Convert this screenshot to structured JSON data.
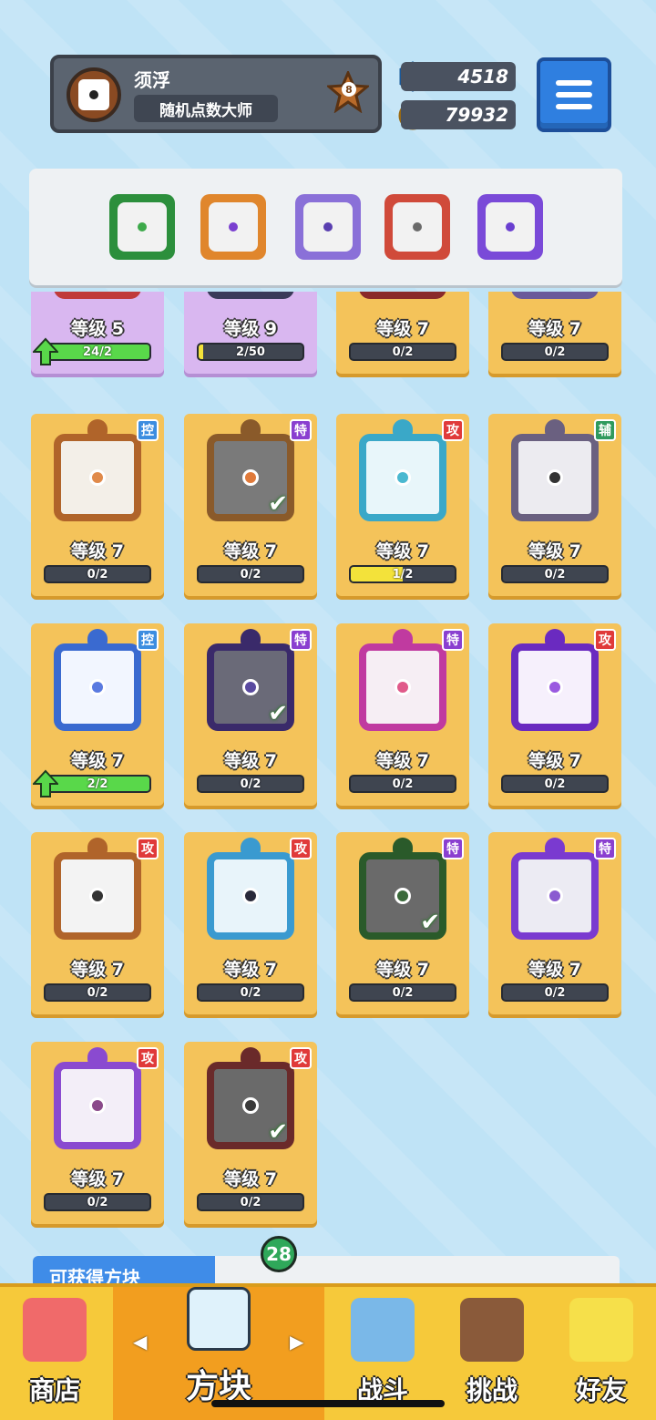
{
  "player": {
    "name": "须浮",
    "title": "随机点数大师",
    "rank": "8"
  },
  "currency": {
    "gems": "4518",
    "coins": "79932"
  },
  "deck": [
    {
      "icon": "wind-die-icon",
      "color": "#3da94a",
      "frame": "#2c8f3c"
    },
    {
      "icon": "infinity-die-icon",
      "color": "#7a3fd0",
      "frame": "#e0862c"
    },
    {
      "icon": "lightning-die-icon",
      "color": "#5a3fb0",
      "frame": "#8a70d8"
    },
    {
      "icon": "saw-die-icon",
      "color": "#6a6a6a",
      "frame": "#d04a3a"
    },
    {
      "icon": "mirror-die-icon",
      "color": "#6a3fd0",
      "frame": "#7a4ad8"
    }
  ],
  "cards": [
    {
      "level": "等级 5",
      "progress": "24/2",
      "fill": 1.0,
      "fill_color": "green",
      "upgradable": true,
      "bg": "purple",
      "tag": "",
      "tag_type": "",
      "frame": "#c03a3a",
      "pip": "#c03a3a",
      "face": "#f3f3f3",
      "checked": false,
      "icon": "die-icon"
    },
    {
      "level": "等级 9",
      "progress": "2/50",
      "fill": 0.04,
      "fill_color": "yellow",
      "upgradable": false,
      "bg": "purple",
      "tag": "",
      "tag_type": "",
      "frame": "#3a3a5a",
      "pip": "#3a3a5a",
      "face": "#f3f3f3",
      "checked": false,
      "icon": "die-icon"
    },
    {
      "level": "等级 7",
      "progress": "0/2",
      "fill": 0,
      "fill_color": "green",
      "upgradable": false,
      "bg": "gold",
      "tag": "",
      "tag_type": "",
      "frame": "#8a2a2a",
      "pip": "#8a2a2a",
      "face": "#f3f3f3",
      "checked": false,
      "icon": "die-icon"
    },
    {
      "level": "等级 7",
      "progress": "0/2",
      "fill": 0,
      "fill_color": "green",
      "upgradable": false,
      "bg": "gold",
      "tag": "",
      "tag_type": "",
      "frame": "#6a5a9a",
      "pip": "#6a5a9a",
      "face": "#f3f3f3",
      "checked": false,
      "icon": "die-icon"
    },
    {
      "level": "等级 7",
      "progress": "0/2",
      "fill": 0,
      "fill_color": "green",
      "upgradable": false,
      "bg": "gold",
      "tag": "控",
      "tag_type": "ctrl",
      "frame": "#b0642a",
      "pip": "#e08a4a",
      "face": "#f3efe8",
      "checked": false,
      "icon": "sand-die-icon"
    },
    {
      "level": "等级 7",
      "progress": "0/2",
      "fill": 0,
      "fill_color": "green",
      "upgradable": false,
      "bg": "gold",
      "tag": "特",
      "tag_type": "spec",
      "frame": "#8a5a2a",
      "pip": "#e07a3a",
      "face": "#7a7a7a",
      "checked": true,
      "icon": "infinity-die-icon"
    },
    {
      "level": "等级 7",
      "progress": "1/2",
      "fill": 0.5,
      "fill_color": "yellow",
      "upgradable": false,
      "bg": "gold",
      "tag": "攻",
      "tag_type": "atk",
      "frame": "#3aa8c8",
      "pip": "#4ab8d0",
      "face": "#e8f6fa",
      "checked": false,
      "icon": "ice-blade-die-icon"
    },
    {
      "level": "等级 7",
      "progress": "0/2",
      "fill": 0,
      "fill_color": "green",
      "upgradable": false,
      "bg": "gold",
      "tag": "辅",
      "tag_type": "sup",
      "frame": "#6a6080",
      "pip": "#333333",
      "face": "#ecebf0",
      "checked": false,
      "icon": "jaw-die-icon"
    },
    {
      "level": "等级 7",
      "progress": "2/2",
      "fill": 1.0,
      "fill_color": "green",
      "upgradable": true,
      "bg": "gold",
      "tag": "控",
      "tag_type": "ctrl",
      "frame": "#3a6ad0",
      "pip": "#5a7ae0",
      "face": "#f2f6ff",
      "checked": false,
      "icon": "snowflake-die-icon"
    },
    {
      "level": "等级 7",
      "progress": "0/2",
      "fill": 0,
      "fill_color": "green",
      "upgradable": false,
      "bg": "gold",
      "tag": "特",
      "tag_type": "spec",
      "frame": "#3a2a6a",
      "pip": "#5a4aa0",
      "face": "#6a6a78",
      "checked": true,
      "icon": "cycle-die-icon"
    },
    {
      "level": "等级 7",
      "progress": "0/2",
      "fill": 0,
      "fill_color": "green",
      "upgradable": false,
      "bg": "gold",
      "tag": "特",
      "tag_type": "spec",
      "frame": "#c03aa0",
      "pip": "#e05a8a",
      "face": "#f6eef4",
      "checked": false,
      "icon": "syringe-die-icon"
    },
    {
      "level": "等级 7",
      "progress": "0/2",
      "fill": 0,
      "fill_color": "green",
      "upgradable": false,
      "bg": "gold",
      "tag": "攻",
      "tag_type": "atk",
      "frame": "#6a2ac0",
      "pip": "#9a5ae0",
      "face": "#f6f0fc",
      "checked": false,
      "icon": "orbit-die-icon"
    },
    {
      "level": "等级 7",
      "progress": "0/2",
      "fill": 0,
      "fill_color": "green",
      "upgradable": false,
      "bg": "gold",
      "tag": "攻",
      "tag_type": "atk",
      "frame": "#b0642a",
      "pip": "#333333",
      "face": "#f3f3f3",
      "checked": false,
      "icon": "gun-die-icon"
    },
    {
      "level": "等级 7",
      "progress": "0/2",
      "fill": 0,
      "fill_color": "green",
      "upgradable": false,
      "bg": "gold",
      "tag": "攻",
      "tag_type": "atk",
      "frame": "#3a9ad0",
      "pip": "#2a2a3a",
      "face": "#e8f4fa",
      "checked": false,
      "icon": "whirlpool-die-icon"
    },
    {
      "level": "等级 7",
      "progress": "0/2",
      "fill": 0,
      "fill_color": "green",
      "upgradable": false,
      "bg": "gold",
      "tag": "特",
      "tag_type": "spec",
      "frame": "#2a5a2a",
      "pip": "#3a6a3a",
      "face": "#6a6a6a",
      "checked": true,
      "icon": "wind-die-icon"
    },
    {
      "level": "等级 7",
      "progress": "0/2",
      "fill": 0,
      "fill_color": "green",
      "upgradable": false,
      "bg": "gold",
      "tag": "特",
      "tag_type": "spec",
      "frame": "#7a3ad0",
      "pip": "#8a5ad0",
      "face": "#ecebf3",
      "checked": false,
      "icon": "mirror-die-icon"
    },
    {
      "level": "等级 7",
      "progress": "0/2",
      "fill": 0,
      "fill_color": "green",
      "upgradable": false,
      "bg": "gold",
      "tag": "攻",
      "tag_type": "atk",
      "frame": "#8a4ad0",
      "pip": "#8a4a8a",
      "face": "#f3eef8",
      "checked": false,
      "icon": "star-die-icon"
    },
    {
      "level": "等级 7",
      "progress": "0/2",
      "fill": 0,
      "fill_color": "green",
      "upgradable": false,
      "bg": "gold",
      "tag": "攻",
      "tag_type": "atk",
      "frame": "#6a2a2a",
      "pip": "#3a3a3a",
      "face": "#6a6a6a",
      "checked": true,
      "icon": "blackhole-die-icon"
    }
  ],
  "available_label": "可获得方块",
  "nav": {
    "shop": "商店",
    "dice": "方块",
    "battle": "战斗",
    "challenge": "挑战",
    "friends": "好友",
    "dice_badge": "28"
  },
  "colors": {
    "background": "#bfe3f6",
    "card_gold": "#f4c35a",
    "card_purple": "#d9b7f0",
    "nav_bg": "#f6c93a",
    "menu_blue": "#2f7fe0"
  }
}
